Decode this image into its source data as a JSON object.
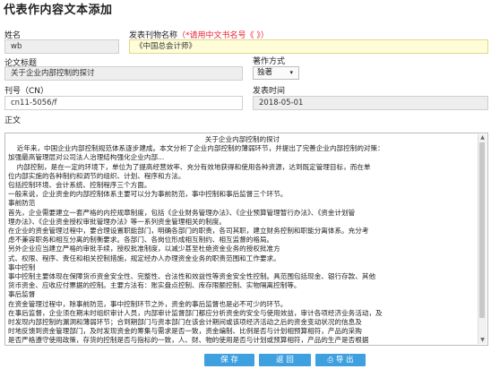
{
  "page": {
    "title": "代表作内容文本添加"
  },
  "form": {
    "name_label": "姓名",
    "name_value": "wb",
    "journal_label": "发表刊物名称",
    "journal_hint": "（*请用中文书名号《 》）",
    "journal_value": "《中国总会计师》",
    "paper_title_label": "论文标题",
    "paper_title_value": "关于企业内部控制的探讨",
    "author_mode_label": "著作方式",
    "author_mode_value": "独著",
    "cn_label": "刊号（CN）",
    "cn_value": "cn11-5056/f",
    "pub_time_label": "发表时间",
    "pub_time_value": "2018-05-01",
    "body_label": "正文"
  },
  "editor": {
    "title": "关于企业内部控制的探讨",
    "lines": [
      "    近年来，中国企业内部控制规范体系逐步建成。本文分析了企业内部控制的薄弱环节，并提出了完善企业内部控制的对策：",
      "加强最高管理层对公司法人治理结构强化企业内部...",
      "    内部控制，是在一定的环境下，单位为了提高经营效率、充分有效地获得和使用各种资源，达到既定管理目标，而在单",
      "位内部实施的各种制约和调节的组织、计划、程序和方法。",
      "包括控制环境、会计系统、控制程序三个方面。",
      "一般来说，企业资金的内部控制体系主要可以分为事前防范，事中控制和事后监督三个环节。",
      "事前防范",
      "首先，企业需要建立一套严格的内控规章制度，包括《企业财务管理办法》、《企业预算管理暂行办法》、《资金计划管",
      "理办法》、《企业资金授权审批管理办法》等一系列资金管理相关的制度。",
      "在企业的资金管理过程中，要合理设置职能部门，明确各部门的职责，各司其职，建立财务控制和职能分离体系。充分考",
      "虑不兼容职务和相互分离的制衡要求。各部门、各岗位形成相互制约、相互监督的格局。",
      "另外企业应当建立严格的审批手续，授权批准制度，以减少甚至杜绝资金业务的授权批准方",
      "式、权限、程序、责任和相关控制措施，规定经办人办理资金业务的职责范围和工作要求。",
      "事中控制",
      "事中控制主要体现在保障货币资金安全性、完整性、合法性和效益性等资金安全性控制。具范围包括现金、银行存款、其他",
      "货币资金、应收应付票据的控制。主要方法有：账实盘点控制、库存限额控制、实物隔离控制等。",
      "事后监督",
      "在资金管理过程中，除事前防范，事中控制环节之外，资金的事后监督也是必不可少的环节。",
      "在事后监督，企业须在期末时组织审计人员，内部审计监督部门都应分析资金的安全与使用效益，审计各项经济业务活动，及",
      "时发现内部控制的漏洞和薄弱环节；合到期部门与资本部门在该会计期间或该项经济活动之后的资金变动状况的信息及",
      "时地反馈到资金管理部门，及时发现资金的筹集与需求是否一致，资金编制、比例是否与计划相预算相符，产品的采购",
      "是否严格遵守使用政策，存货的控制是否与指标的一致，人、财、物的使用是否与计划或预算相符，产品的生产是否根据",
      "计划或预算合理安排等。"
    ]
  },
  "buttons": {
    "save": "保 存",
    "back": "返 回",
    "export": "导 出"
  }
}
